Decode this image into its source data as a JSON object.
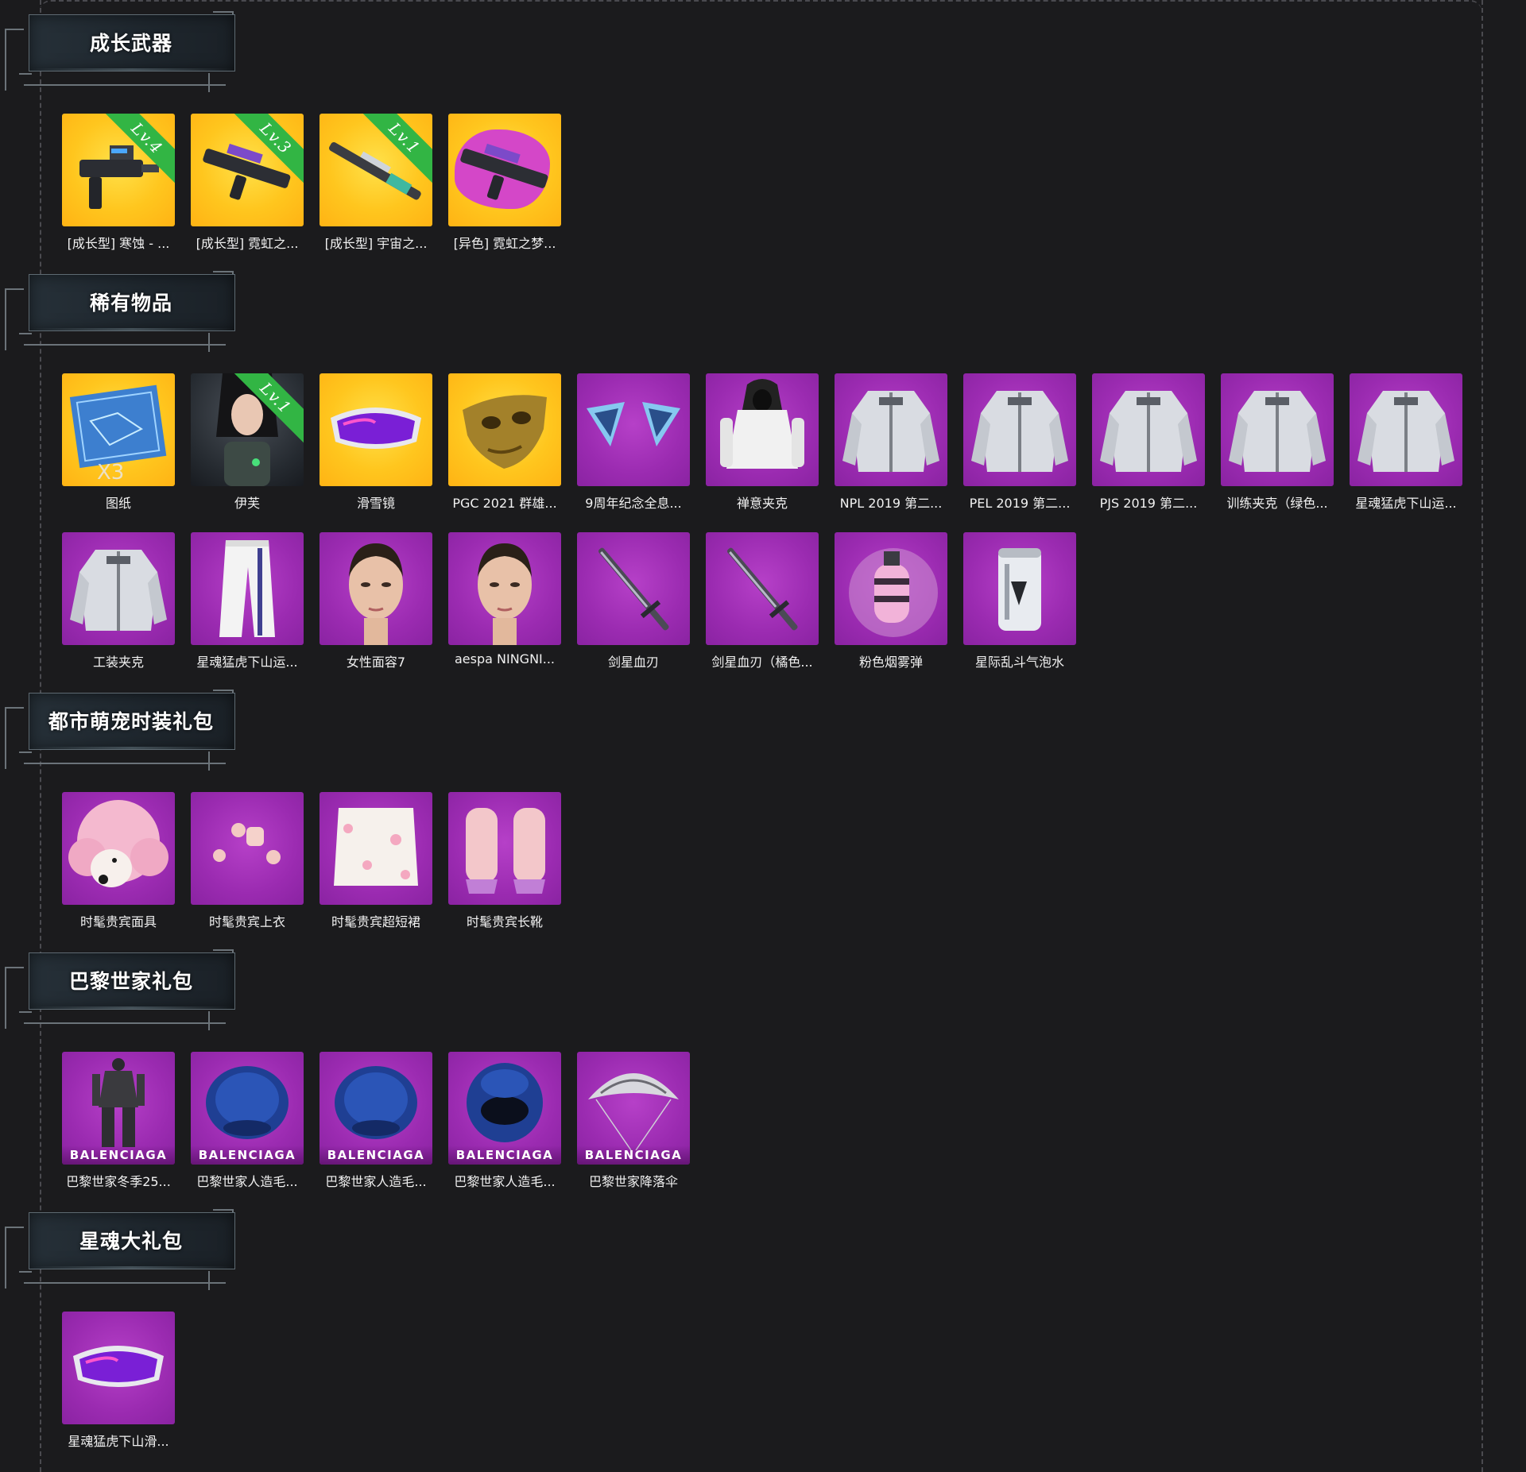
{
  "sections": [
    {
      "title": "成长武器",
      "items": [
        {
          "label": "[成长型] 寒蚀 - ...",
          "bg": "gold",
          "badge": "Lv.4",
          "icon": "smg-icon"
        },
        {
          "label": "[成长型] 霓虹之...",
          "bg": "gold",
          "badge": "Lv.3",
          "icon": "rifle-icon"
        },
        {
          "label": "[成长型] 宇宙之...",
          "bg": "gold",
          "badge": "Lv.1",
          "icon": "sniper-icon"
        },
        {
          "label": "[异色] 霓虹之梦...",
          "bg": "gold-splash",
          "badge": "",
          "icon": "rifle-icon"
        }
      ]
    },
    {
      "title": "稀有物品",
      "items": [
        {
          "label": "图纸",
          "bg": "gold",
          "badge": "",
          "extra": "X3",
          "icon": "blueprint-icon"
        },
        {
          "label": "伊芙",
          "bg": "dark",
          "badge": "Lv.1",
          "icon": "character-icon"
        },
        {
          "label": "滑雪镜",
          "bg": "gold",
          "badge": "",
          "icon": "goggles-icon"
        },
        {
          "label": "PGC 2021 群雄...",
          "bg": "gold",
          "badge": "",
          "icon": "mask-icon"
        },
        {
          "label": "9周年纪念全息...",
          "bg": "purple",
          "badge": "",
          "icon": "cat-ears-icon"
        },
        {
          "label": "禅意夹克",
          "bg": "purple",
          "badge": "",
          "icon": "hoodie-icon"
        },
        {
          "label": "NPL 2019 第二...",
          "bg": "purple",
          "badge": "",
          "icon": "jacket-icon"
        },
        {
          "label": "PEL 2019 第二...",
          "bg": "purple",
          "badge": "",
          "icon": "jacket-icon"
        },
        {
          "label": "PJS 2019 第二...",
          "bg": "purple",
          "badge": "",
          "icon": "jacket-icon"
        },
        {
          "label": "训练夹克（绿色...",
          "bg": "purple",
          "badge": "",
          "icon": "jacket-icon"
        },
        {
          "label": "星魂猛虎下山运...",
          "bg": "purple",
          "badge": "",
          "icon": "jacket-icon"
        },
        {
          "label": "工装夹克",
          "bg": "purple",
          "badge": "",
          "icon": "jacket-icon"
        },
        {
          "label": "星魂猛虎下山运...",
          "bg": "purple",
          "badge": "",
          "icon": "pants-icon"
        },
        {
          "label": "女性面容7",
          "bg": "purple",
          "badge": "",
          "icon": "face-icon"
        },
        {
          "label": "aespa NINGNI...",
          "bg": "purple",
          "badge": "",
          "icon": "face-icon"
        },
        {
          "label": "剑星血刃",
          "bg": "purple",
          "badge": "",
          "icon": "sword-icon"
        },
        {
          "label": "剑星血刃（橘色...",
          "bg": "purple",
          "badge": "",
          "icon": "sword-icon"
        },
        {
          "label": "粉色烟雾弹",
          "bg": "purple",
          "badge": "",
          "icon": "grenade-icon"
        },
        {
          "label": "星际乱斗气泡水",
          "bg": "purple",
          "badge": "",
          "icon": "can-icon"
        }
      ]
    },
    {
      "title": "都市萌宠时装礼包",
      "items": [
        {
          "label": "时髦贵宾面具",
          "bg": "purple",
          "badge": "",
          "icon": "poodle-mask-icon"
        },
        {
          "label": "时髦贵宾上衣",
          "bg": "purple",
          "badge": "",
          "icon": "pompom-icon"
        },
        {
          "label": "时髦贵宾超短裙",
          "bg": "purple",
          "badge": "",
          "icon": "skirt-icon"
        },
        {
          "label": "时髦贵宾长靴",
          "bg": "purple",
          "badge": "",
          "icon": "boots-icon"
        }
      ]
    },
    {
      "title": "巴黎世家礼包",
      "items": [
        {
          "label": "巴黎世家冬季25...",
          "bg": "purple",
          "badge": "",
          "brand": "BALENCIAGA",
          "icon": "outfit-icon"
        },
        {
          "label": "巴黎世家人造毛...",
          "bg": "purple",
          "badge": "",
          "brand": "BALENCIAGA",
          "icon": "fur-hat-icon"
        },
        {
          "label": "巴黎世家人造毛...",
          "bg": "purple",
          "badge": "",
          "brand": "BALENCIAGA",
          "icon": "fur-hat-icon"
        },
        {
          "label": "巴黎世家人造毛...",
          "bg": "purple",
          "badge": "",
          "brand": "BALENCIAGA",
          "icon": "fur-helmet-icon"
        },
        {
          "label": "巴黎世家降落伞",
          "bg": "purple",
          "badge": "",
          "brand": "BALENCIAGA",
          "icon": "parachute-icon"
        }
      ]
    },
    {
      "title": "星魂大礼包",
      "items": [
        {
          "label": "星魂猛虎下山滑...",
          "bg": "purple",
          "badge": "",
          "icon": "goggles-icon"
        }
      ]
    }
  ]
}
